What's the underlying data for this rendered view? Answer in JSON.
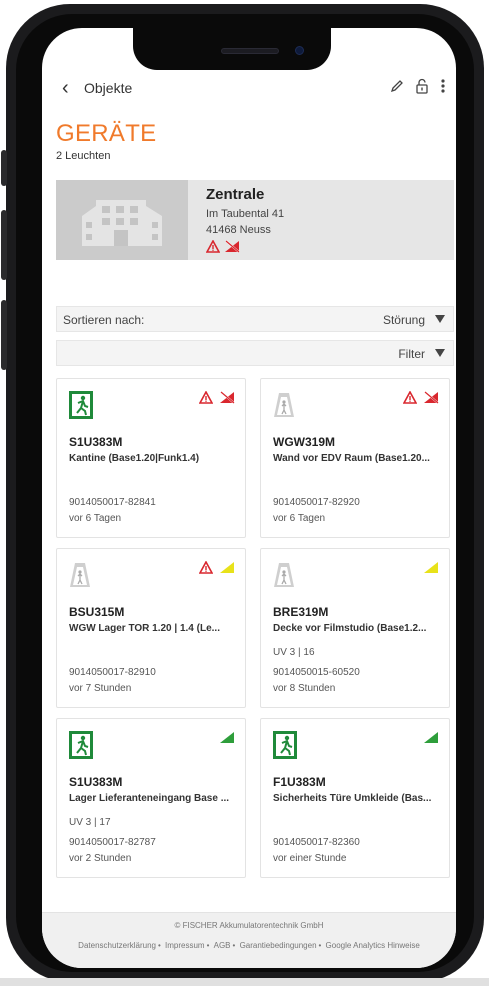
{
  "appbar": {
    "back_label": "Objekte"
  },
  "page": {
    "title": "GERÄTE",
    "subtitle": "2 Leuchten"
  },
  "building": {
    "name": "Zentrale",
    "street": "Im Taubental 41",
    "city": "41468 Neuss"
  },
  "sort": {
    "label": "Sortieren nach:",
    "value": "Störung"
  },
  "filter": {
    "value": "Filter"
  },
  "devices": [
    {
      "code": "S1U383M",
      "desc": "Kantine (Base1.20|Funk1.4)",
      "uv": "",
      "serial": "9014050017-82841",
      "time": "vor 6 Tagen"
    },
    {
      "code": "WGW319M",
      "desc": "Wand vor EDV Raum (Base1.20...",
      "uv": "",
      "serial": "9014050017-82920",
      "time": "vor 6 Tagen"
    },
    {
      "code": "BSU315M",
      "desc": "WGW Lager TOR 1.20 | 1.4 (Le...",
      "uv": "",
      "serial": "9014050017-82910",
      "time": "vor 7 Stunden"
    },
    {
      "code": "BRE319M",
      "desc": "Decke vor Filmstudio (Base1.2...",
      "uv": "UV 3 | 16",
      "serial": "9014050015-60520",
      "time": "vor 8 Stunden"
    },
    {
      "code": "S1U383M",
      "desc": "Lager Lieferanteneingang Base ...",
      "uv": "UV 3 | 17",
      "serial": "9014050017-82787",
      "time": "vor 2 Stunden"
    },
    {
      "code": "F1U383M",
      "desc": "Sicherheits Türe Umkleide (Bas...",
      "uv": "",
      "serial": "9014050017-82360",
      "time": "vor einer Stunde"
    }
  ],
  "footer": {
    "copyright": "© FISCHER Akkumulatorentechnik GmbH",
    "links": [
      "Datenschutzerklärung",
      "Impressum",
      "AGB",
      "Garantiebedingungen",
      "Google Analytics Hinweise"
    ]
  },
  "colors": {
    "accent": "#f07a2b",
    "warning_red": "#d9272e",
    "status_yellow": "#e8e21a",
    "status_green": "#2e9e3b",
    "exit_green": "#1f8a3a"
  },
  "icons": [
    "back-chevron-icon",
    "edit-pencil-icon",
    "lock-icon",
    "more-vertical-icon",
    "building-icon",
    "warning-triangle-icon",
    "no-signal-icon",
    "exit-sign-icon",
    "lamp-icon",
    "status-corner-icon",
    "dropdown-caret-icon"
  ]
}
